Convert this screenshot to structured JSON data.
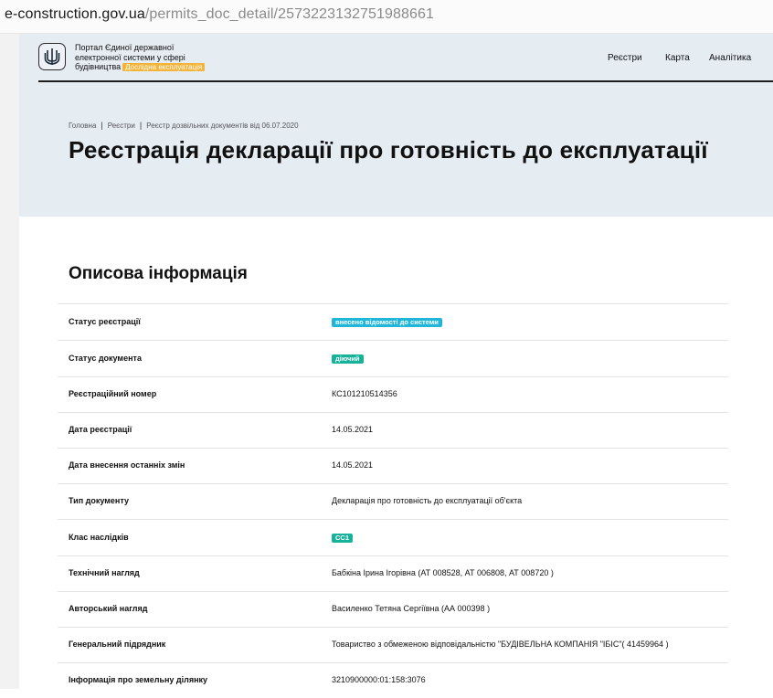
{
  "browser": {
    "url_domain": "e-construction.gov.ua",
    "url_path": "/permits_doc_detail/2573223132751988661"
  },
  "header": {
    "portal_line1": "Портал Єдиної державної",
    "portal_line2": "електронної системи у сфері",
    "portal_line3": "будівництва",
    "portal_badge": "Дослідна експлуатація",
    "logo_icon": "trident-icon",
    "nav": [
      "Реєстри",
      "Карта",
      "Аналітика"
    ]
  },
  "breadcrumb": [
    "Головна",
    "Реєстри",
    "Реєстр дозвільних документів від 06.07.2020"
  ],
  "page_title": "Реєстрація декларації про готовність до експлуатації",
  "section_title": "Описова інформація",
  "colors": {
    "accent_blue": "#1fb6da",
    "accent_green": "#16b39a",
    "badge_orange": "#f4b43a",
    "hero_bg": "#e5ecf2"
  },
  "rows": [
    {
      "label": "Статус реєстрації",
      "value": "внесено відомості до системи",
      "type": "badge",
      "color": "#1fb6da"
    },
    {
      "label": "Статус документа",
      "value": "діючий",
      "type": "badge",
      "color": "#16b39a"
    },
    {
      "label": "Реєстраційний номер",
      "value": "КС101210514356",
      "type": "text"
    },
    {
      "label": "Дата реєстрації",
      "value": "14.05.2021",
      "type": "text"
    },
    {
      "label": "Дата внесення останніх змін",
      "value": "14.05.2021",
      "type": "text"
    },
    {
      "label": "Тип документу",
      "value": "Декларація про готовність до експлуатації об'єкта",
      "type": "text"
    },
    {
      "label": "Клас наслідків",
      "value": "СС1",
      "type": "badge",
      "color": "#16b39a"
    },
    {
      "label": "Технічний нагляд",
      "value": "Бабкіна Ірина Ігорівна (АТ 008528, АТ 006808, АТ 008720 )",
      "type": "text"
    },
    {
      "label": "Авторський нагляд",
      "value": "Василенко Тетяна Сергіївна (АА 000398 )",
      "type": "text"
    },
    {
      "label": "Генеральний підрядник",
      "value": "Товариство з обмеженою відповідальністю \"БУДІВЕЛЬНА КОМПАНІЯ \"ІБІС\"( 41459964 )",
      "type": "text"
    },
    {
      "label": "Інформація про земельну ділянку",
      "value": "3210900000:01:158:3076",
      "type": "text"
    }
  ]
}
